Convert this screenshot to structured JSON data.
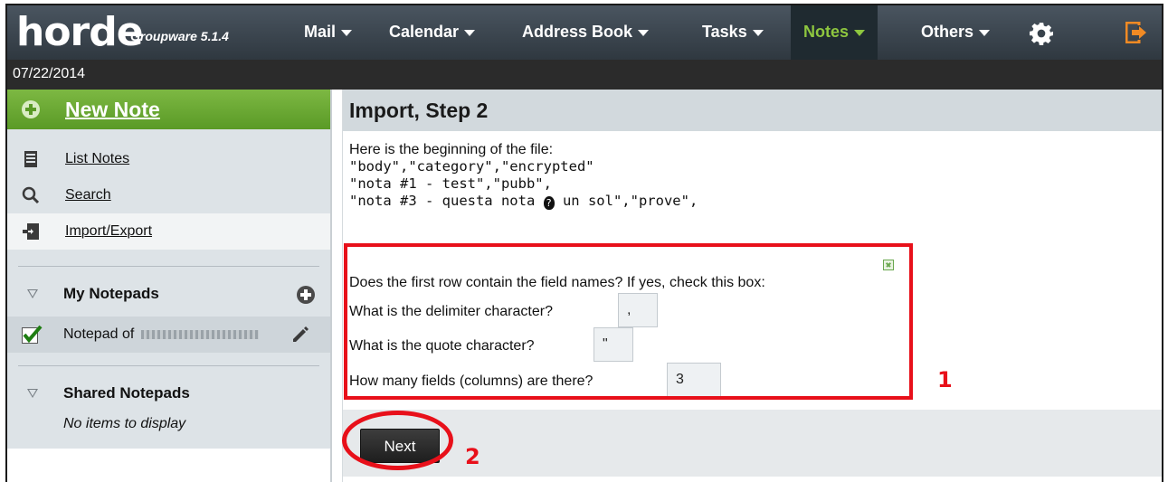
{
  "app": {
    "logo_text": "horde",
    "logo_subtitle": "Groupware 5.1.4"
  },
  "nav": {
    "items": [
      {
        "label": "Mail"
      },
      {
        "label": "Calendar"
      },
      {
        "label": "Address Book"
      },
      {
        "label": "Tasks"
      },
      {
        "label": "Notes",
        "active": true
      },
      {
        "label": "Others"
      }
    ],
    "settings_icon": "gear-icon",
    "logout_icon": "logout-icon"
  },
  "date": "07/22/2014",
  "sidebar": {
    "new_note_label": "New Note",
    "links": [
      {
        "label": "List Notes",
        "icon": "list-icon"
      },
      {
        "label": "Search",
        "icon": "search-icon"
      },
      {
        "label": "Import/Export",
        "icon": "import-export-icon",
        "active": true
      }
    ],
    "my_notepads": {
      "title": "My Notepads",
      "items": [
        {
          "label": "Notepad of",
          "checked": true
        }
      ]
    },
    "shared_notepads": {
      "title": "Shared Notepads",
      "empty_text": "No items to display"
    }
  },
  "main": {
    "title": "Import, Step 2",
    "file_intro": "Here is the beginning of the file:",
    "file_lines": [
      "\"body\",\"category\",\"encrypted\"",
      "\"nota #1 - test\",\"pubb\",",
      "\"nota #3 - questa nota ",
      " un sol\",\"prove\","
    ],
    "questions": {
      "header_row": "Does the first row contain the field names? If yes, check this box:",
      "header_row_checked": true,
      "delimiter_label": "What is the delimiter character?",
      "delimiter_value": ",",
      "quote_label": "What is the quote character?",
      "quote_value": "\"",
      "fields_label": "How many fields (columns) are there?",
      "fields_value": "3"
    },
    "next_label": "Next"
  },
  "annotations": {
    "label_1": "1",
    "label_2": "2",
    "color": "#e8101a"
  }
}
